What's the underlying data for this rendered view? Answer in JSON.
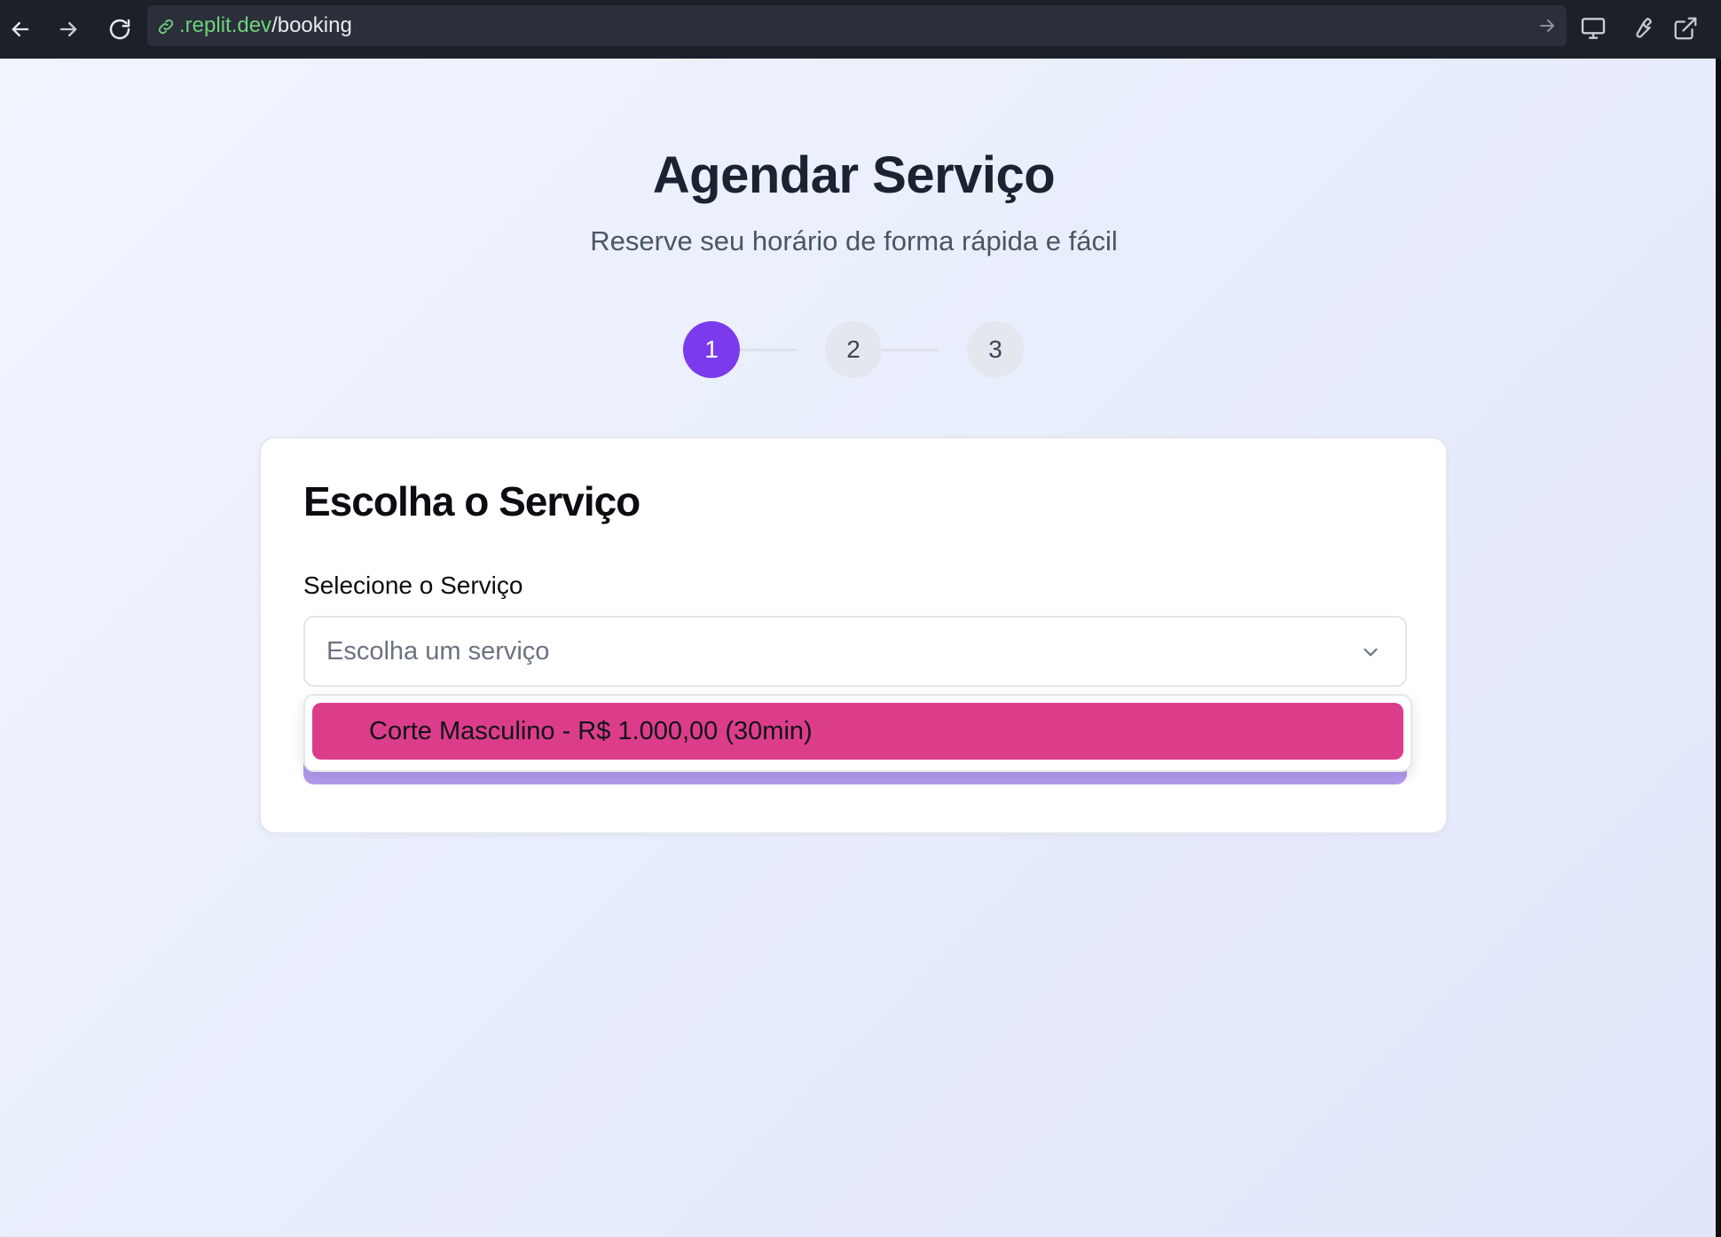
{
  "browser": {
    "url_domain": ".replit.dev",
    "url_path": "/booking",
    "icons": [
      "back-arrow-icon",
      "forward-arrow-icon",
      "reload-icon",
      "link-icon",
      "go-arrow-icon",
      "monitor-icon",
      "wrench-icon",
      "external-link-icon"
    ]
  },
  "header": {
    "title": "Agendar Serviço",
    "subtitle": "Reserve seu horário de forma rápida e fácil"
  },
  "stepper": {
    "steps": [
      {
        "label": "1",
        "active": true
      },
      {
        "label": "2",
        "active": false
      },
      {
        "label": "3",
        "active": false
      }
    ]
  },
  "card": {
    "title": "Escolha o Serviço",
    "field_label": "Selecione o Serviço",
    "select_placeholder": "Escolha um serviço",
    "dropdown_options": [
      {
        "label": "Corte Masculino - R$ 1.000,00 (30min)",
        "highlighted": true
      }
    ]
  },
  "colors": {
    "accent": "#7c3aed",
    "option_highlight": "#dc3d8b",
    "url_domain": "#6fd17c"
  }
}
